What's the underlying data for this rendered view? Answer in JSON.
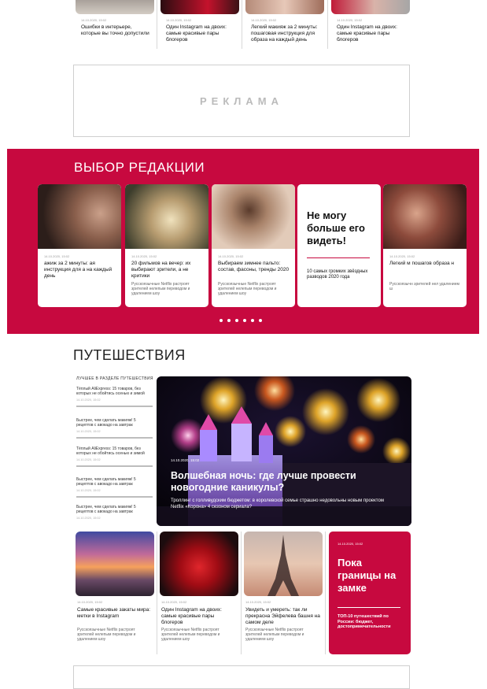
{
  "top_strip": [
    {
      "date": "14.10.2020, 15:02",
      "title": "Ошибки в интерьере, которые вы точно допустили"
    },
    {
      "date": "14.10.2020, 15:02",
      "title": "Один Instagram на двоих: самые красивые пары блогеров"
    },
    {
      "date": "14.10.2020, 15:02",
      "title": "Легкий макияж за 2 минуты: пошаговая инструкция для образа на каждый день"
    },
    {
      "date": "14.10.2020, 15:02",
      "title": "Один Instagram на двоих: самые красивые пары блогеров"
    }
  ],
  "ad": {
    "label": "РЕКЛАМА"
  },
  "editors": {
    "title": "ВЫБОР РЕДАКЦИИ",
    "cards": [
      {
        "date": "14.10.2020, 15:02",
        "title": "ажиж за 2 минуты: ая инструкция для а на каждый день",
        "desc": "",
        "image": "woman-portrait"
      },
      {
        "date": "14.10.2020, 15:02",
        "title": "20 фильмов на вечер: их выбирают зрители, а не критики",
        "desc": "Русскоязычные Netflix растроят зрителей нелепым переводом и удалением шоу",
        "image": "film-still"
      },
      {
        "date": "14.10.2020, 15:02",
        "title": "Выбираем зимнее пальто: состав, фасоны, тренды 2020",
        "desc": "Русскоязычные Netflix растроят зрителей нелепым переводом и удалением шоу",
        "image": "woman-coat"
      },
      {
        "big": "Не могу больше его видеть!",
        "small": "10 самых громких звёздных разводов 2020 года"
      },
      {
        "date": "14.10.2020, 15:02",
        "title": "Легкий м пошагов образа н",
        "desc": "Русскоязычн зрителей нел удалением ш",
        "image": "woman-portrait-2"
      }
    ],
    "dots": 6
  },
  "travel": {
    "title": "ПУТЕШЕСТВИЯ",
    "list_heading": "ЛУЧШЕЕ В РАЗДЕЛЕ ПУТЕШЕСТВИЯ",
    "list": [
      {
        "title": "Тёплый AliExpress: 15 товаров, без которых не обойтись осенью и зимой",
        "date": "14.10.2020, 15:02"
      },
      {
        "title": "Быстрее, чем сделать макияж! 5 рецептов с авокадо на завтрак",
        "date": "14.10.2020, 15:02"
      },
      {
        "title": "Тёплый AliExpress: 15 товаров, без которых не обойтись осенью и зимой",
        "date": "14.10.2020, 15:02"
      },
      {
        "title": "Быстрее, чем сделать макияж! 5 рецептов с авокадо на завтрак",
        "date": "14.10.2020, 15:02"
      },
      {
        "title": "Быстрее, чем сделать макияж! 5 рецептов с авокадо на завтрак",
        "date": "14.10.2020, 15:02"
      }
    ],
    "hero": {
      "date": "14.10.2020, 15:02",
      "title": "Волшебная ночь: где лучше провести новогодние каникулы?",
      "subtitle": "Троллинг с голливудским бюджетом: в королевской семье страшно недовольны новым проектом Netflix «Корона» 4 сезоном сериала?"
    },
    "cards": [
      {
        "date": "14.10.2020, 15:02",
        "title": "Самые красивые закаты мира: метки в Instagram",
        "desc": "Русскоязычные Netflix растроят зрителей нелепым переводом и удалением шоу",
        "image": "sunset-beach"
      },
      {
        "date": "14.10.2020, 15:02",
        "title": "Один Instagram на двоих: самые красивые пары блогеров",
        "desc": "Русскоязычные Netflix растроят зрителей нелепым переводом и удалением шоу",
        "image": "woman-red-coat"
      },
      {
        "date": "14.10.2020, 15:02",
        "title": "Увидеть и умереть: так ли прекрасна Эйфелева башня на самом деле",
        "desc": "Русскоязычные Netflix растроят зрителей нелепым переводом и удалением шоу",
        "image": "eiffel-tower"
      }
    ],
    "red_card": {
      "date": "14.10.2020, 15:02",
      "title": "Пока границы на замке",
      "subtitle": "ТОП-10 путешествий по России: бюджет, достопримечательности"
    }
  },
  "colors": {
    "accent": "#c7093f",
    "divider": "#d8d8d8"
  }
}
